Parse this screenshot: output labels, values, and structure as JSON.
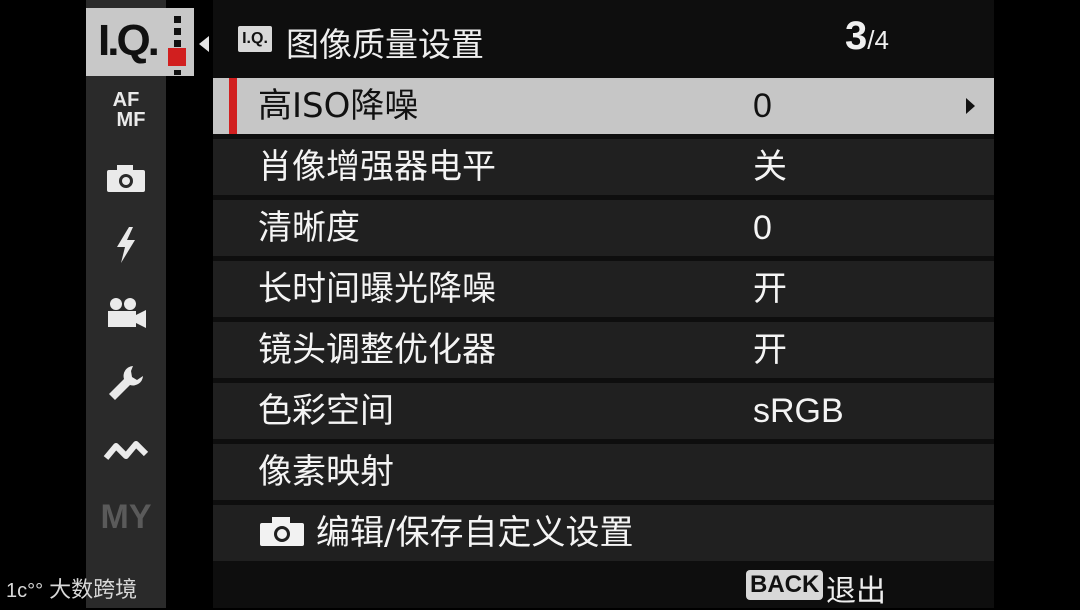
{
  "menu": {
    "tab_badge": "I.Q.",
    "header_badge": "I.Q.",
    "title": "图像质量设置",
    "page_current": "3",
    "page_total": "/4"
  },
  "sidebar": {
    "af_mf_top": "AF",
    "af_mf_bottom": "MF",
    "my_label": "MY",
    "icons": [
      "camera-icon",
      "flash-icon",
      "movie-icon",
      "wrench-icon",
      "connection-icon"
    ]
  },
  "rows": [
    {
      "label": "高ISO降噪",
      "value": "0"
    },
    {
      "label": "肖像增强器电平",
      "value": "关"
    },
    {
      "label": "清晰度",
      "value": "0"
    },
    {
      "label": "长时间曝光降噪",
      "value": "开"
    },
    {
      "label": "镜头调整优化器",
      "value": "开"
    },
    {
      "label": "色彩空间",
      "value": "sRGB"
    },
    {
      "label": "像素映射",
      "value": ""
    },
    {
      "label": "编辑/保存自定义设置",
      "value": ""
    }
  ],
  "footer": {
    "back_key": "BACK",
    "back_label": "退出"
  },
  "watermark": {
    "logo": "1c°°",
    "text": "大数跨境"
  },
  "colors": {
    "accent": "#d11f1f",
    "selected_row": "#c6c6c6",
    "row": "#202020"
  }
}
